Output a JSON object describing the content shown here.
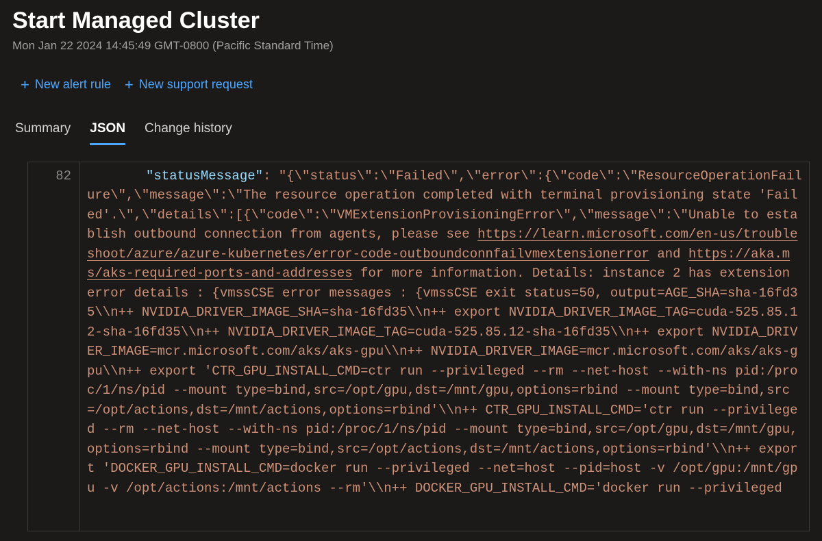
{
  "header": {
    "title": "Start Managed Cluster",
    "subtitle": "Mon Jan 22 2024 14:45:49 GMT-0800 (Pacific Standard Time)"
  },
  "toolbar": {
    "new_alert_rule": "New alert rule",
    "new_support_request": "New support request"
  },
  "tabs": {
    "summary": "Summary",
    "json": "JSON",
    "change_history": "Change history",
    "active": "json"
  },
  "json_view": {
    "line_number": "82",
    "key": "\"statusMessage\"",
    "value_pre_link1": ": \"{\\\"status\\\":\\\"Failed\\\",\\\"error\\\":{\\\"code\\\":\\\"ResourceOperationFailure\\\",\\\"message\\\":\\\"The resource operation completed with terminal provisioning state 'Failed'.\\\",\\\"details\\\":[{\\\"code\\\":\\\"VMExtensionProvisioningError\\\",\\\"message\\\":\\\"Unable to establish outbound connection from agents, please see ",
    "link1_text": "https://learn.microsoft.com/en-us/troubleshoot/azure/azure-kubernetes/error-code-outboundconnfailvmextensionerror",
    "between_links": " and ",
    "link2_text": "https://aka.ms/aks-required-ports-and-addresses",
    "value_post_link2": " for more information. Details: instance 2 has extension error details : {vmssCSE error messages : {vmssCSE exit status=50, output=AGE_SHA=sha-16fd35\\\\n++ NVIDIA_DRIVER_IMAGE_SHA=sha-16fd35\\\\n++ export NVIDIA_DRIVER_IMAGE_TAG=cuda-525.85.12-sha-16fd35\\\\n++ NVIDIA_DRIVER_IMAGE_TAG=cuda-525.85.12-sha-16fd35\\\\n++ export NVIDIA_DRIVER_IMAGE=mcr.microsoft.com/aks/aks-gpu\\\\n++ NVIDIA_DRIVER_IMAGE=mcr.microsoft.com/aks/aks-gpu\\\\n++ export 'CTR_GPU_INSTALL_CMD=ctr run --privileged --rm --net-host --with-ns pid:/proc/1/ns/pid --mount type=bind,src=/opt/gpu,dst=/mnt/gpu,options=rbind --mount type=bind,src=/opt/actions,dst=/mnt/actions,options=rbind'\\\\n++ CTR_GPU_INSTALL_CMD='ctr run --privileged --rm --net-host --with-ns pid:/proc/1/ns/pid --mount type=bind,src=/opt/gpu,dst=/mnt/gpu,options=rbind --mount type=bind,src=/opt/actions,dst=/mnt/actions,options=rbind'\\\\n++ export 'DOCKER_GPU_INSTALL_CMD=docker run --privileged --net=host --pid=host -v /opt/gpu:/mnt/gpu -v /opt/actions:/mnt/actions --rm'\\\\n++ DOCKER_GPU_INSTALL_CMD='docker run --privileged"
  }
}
